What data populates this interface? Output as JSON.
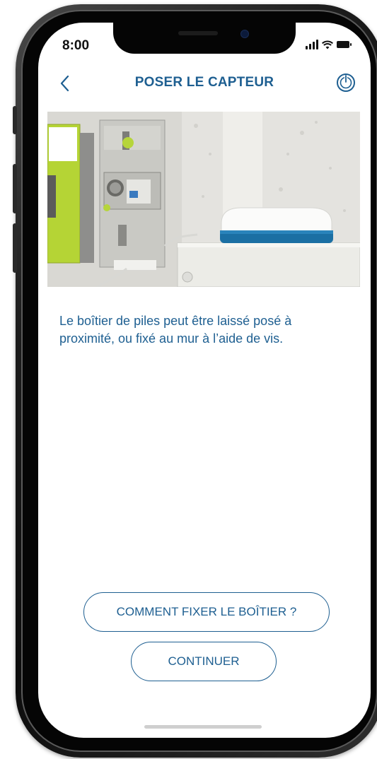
{
  "status_bar": {
    "time": "8:00"
  },
  "header": {
    "title": "POSER LE CAPTEUR",
    "back_icon": "chevron-left-icon",
    "power_icon": "power-icon"
  },
  "content": {
    "instruction": "Le boîtier de piles peut être laissé posé à proximité, ou fixé au mur à l’aide de vis."
  },
  "actions": {
    "fix_button_label": "COMMENT FIXER LE BOÎTIER ?",
    "continue_button_label": "CONTINUER"
  },
  "colors": {
    "accent": "#1e5f91",
    "background": "#ffffff"
  }
}
